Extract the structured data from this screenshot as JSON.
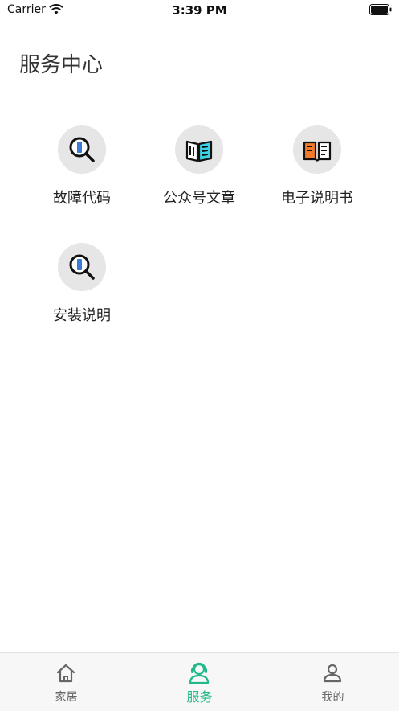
{
  "status_bar": {
    "carrier": "Carrier",
    "time": "3:39 PM"
  },
  "page": {
    "title": "服务中心"
  },
  "services": [
    {
      "label": "故障代码",
      "icon": "magnifier-fault-icon"
    },
    {
      "label": "公众号文章",
      "icon": "open-book-article-icon"
    },
    {
      "label": "电子说明书",
      "icon": "manual-book-icon"
    },
    {
      "label": "安装说明",
      "icon": "magnifier-install-icon"
    }
  ],
  "tab_bar": {
    "items": [
      {
        "label": "家居",
        "icon": "home-icon",
        "active": false
      },
      {
        "label": "服务",
        "icon": "customer-service-icon",
        "active": true
      },
      {
        "label": "我的",
        "icon": "user-icon",
        "active": false
      }
    ],
    "active_color": "#21b98a",
    "inactive_color": "#666666"
  }
}
